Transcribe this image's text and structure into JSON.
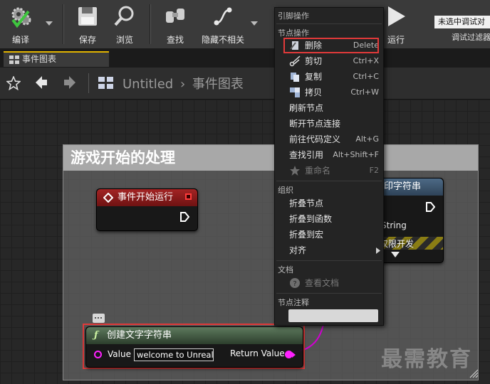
{
  "toolbar": {
    "compile_label": "编译",
    "save_label": "保存",
    "browse_label": "浏览",
    "find_label": "查找",
    "hide_unrelated_label": "隐藏不相关",
    "run_label": "运行",
    "debug_select_value": "未选中调试对",
    "debug_filter_label": "调试过滤器"
  },
  "tab": {
    "label": "事件图表"
  },
  "breadcrumb": {
    "project": "Untitled",
    "separator": "›",
    "graph": "事件图表"
  },
  "comment": {
    "title": "游戏开始的处理"
  },
  "nodes": {
    "begin_play": {
      "title": "事件开始运行"
    },
    "print_string": {
      "title_partial": "印字符串",
      "pin_partial": "String",
      "dev_only_partial": "仅限开发"
    },
    "make_literal": {
      "title": "创建文字字符串",
      "value_pin_label": "Value",
      "value_input": "welcome to Unreal!",
      "return_pin_label": "Return Value"
    }
  },
  "context_menu": {
    "pin_actions_header": "引脚操作",
    "node_actions_header": "节点操作",
    "items": [
      {
        "label": "删除",
        "shortcut": "Delete",
        "icon": "delete-icon",
        "highlighted": true
      },
      {
        "label": "剪切",
        "shortcut": "Ctrl+X",
        "icon": "scissors-icon"
      },
      {
        "label": "复制",
        "shortcut": "Ctrl+C",
        "icon": "copy-icon"
      },
      {
        "label": "拷贝",
        "shortcut": "Ctrl+W",
        "icon": "duplicate-icon"
      },
      {
        "label": "刷新节点",
        "shortcut": ""
      },
      {
        "label": "断开节点连接",
        "shortcut": ""
      },
      {
        "label": "前往代码定义",
        "shortcut": "Alt+G"
      },
      {
        "label": "查找引用",
        "shortcut": "Alt+Shift+F"
      },
      {
        "label": "重命名",
        "shortcut": "F2",
        "icon": "rename-icon",
        "disabled": true
      }
    ],
    "organize_header": "组织",
    "organize_items": [
      {
        "label": "折叠节点"
      },
      {
        "label": "折叠到函数"
      },
      {
        "label": "折叠到宏"
      },
      {
        "label": "对齐",
        "submenu": true
      }
    ],
    "docs_header": "文档",
    "docs_item": "查看文档",
    "comment_header": "节点注释",
    "comment_input_value": ""
  },
  "watermark": "最需教育",
  "colors": {
    "event_header": "#8b1a1a",
    "function_header": "#3f5a3f",
    "highlight_border": "#e23a3a",
    "tab_accent": "#e2b400"
  }
}
